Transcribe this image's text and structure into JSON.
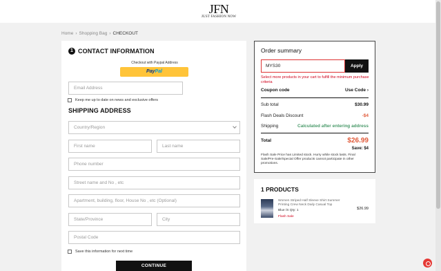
{
  "header": {
    "logo_main": "JFN",
    "logo_sub": "JUST FASHION NOW"
  },
  "breadcrumb": [
    {
      "label": "Home"
    },
    {
      "label": "Shopping Bag"
    },
    {
      "label": "CHECKOUT"
    }
  ],
  "breadcrumb_separator": "›",
  "contact": {
    "step": "1",
    "title": "CONTACT INFORMATION",
    "paypal_caption": "Checkout with Paypal Address",
    "paypal_label_1": "Pay",
    "paypal_label_2": "Pal",
    "email_placeholder": "Email Address",
    "newsletter_label": "Keep me up to date on news and exclusive offers"
  },
  "shipping": {
    "title": "SHIPPING ADDRESS",
    "country_placeholder": "Country/Region",
    "first_name_placeholder": "First name",
    "last_name_placeholder": "Last name",
    "phone_placeholder": "Phone number",
    "street_placeholder": "Street name and No , etc",
    "apartment_placeholder": "Apartment, building, floor, House No , etc (Optional)",
    "state_placeholder": "State/Province",
    "city_placeholder": "City",
    "postal_placeholder": "Postal Code",
    "save_label": "Save this information for next time",
    "continue_label": "CONTINUE"
  },
  "summary": {
    "title": "Order summary",
    "coupon_value": "MYS30",
    "apply_label": "Apply",
    "coupon_error": "Select more products in your cart to fulfill the minimum purchase criteria",
    "coupon_code_label": "Coupon code",
    "use_code_label": "Use Code",
    "use_code_arrow": "›",
    "subtotal_label": "Sub total",
    "subtotal_value": "$30.99",
    "flash_label": "Flash Deals Discount",
    "flash_value": "-$4",
    "shipping_label": "Shipping",
    "shipping_value": "Calculated after entering address",
    "total_label": "Total",
    "total_value": "$26.99",
    "save_text": "Save: $4",
    "flash_note": "Flash Sale Price has Limited stock. Hurry while stock lasts. Final Sale/Pre-Sale/Special Offer products cannot participate in other promotions."
  },
  "products": {
    "title": "1 PRODUCTS",
    "items": [
      {
        "name": "Women Striped Half Sleeve Shirt Summer Printing Crew Neck Daily Casual Top",
        "variant": "Blue /S   Qty: 1",
        "tag": "Flash Sale",
        "price": "$26.99"
      }
    ]
  },
  "colors": {
    "accent": "#111111",
    "error": "#d0021b",
    "total": "#e05a3a",
    "shipping_info": "#4a9a6a",
    "paypal": "#ffc439",
    "help_bubble": "#e53935"
  }
}
